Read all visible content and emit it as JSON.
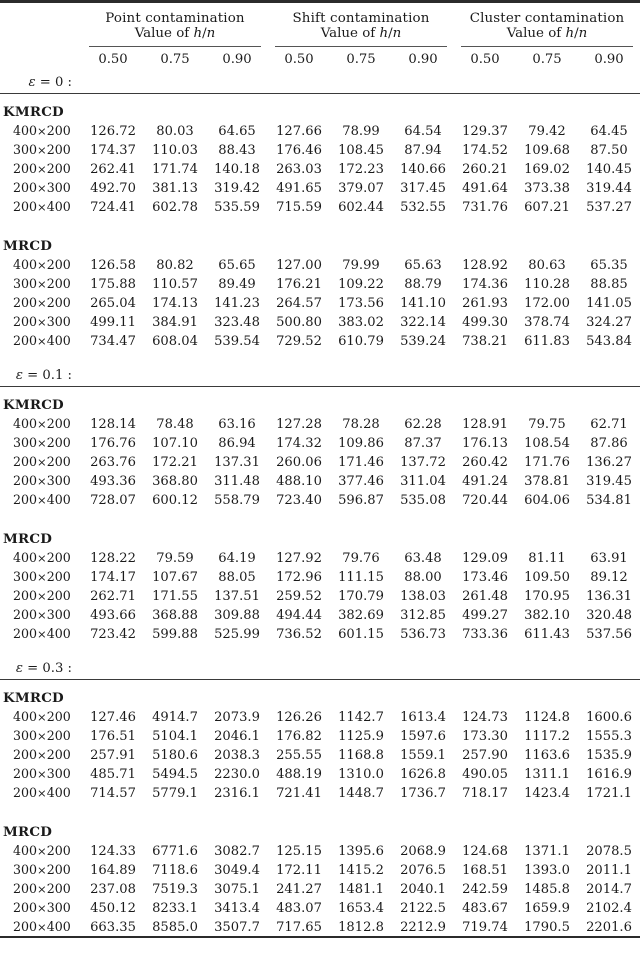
{
  "table": {
    "groups": [
      {
        "title": "Point contamination",
        "subtitle": "Value of h/n"
      },
      {
        "title": "Shift contamination",
        "subtitle": "Value of h/n"
      },
      {
        "title": "Cluster contamination",
        "subtitle": "Value of h/n"
      }
    ],
    "hn_headers": [
      "0.50",
      "0.75",
      "0.90",
      "0.50",
      "0.75",
      "0.90",
      "0.50",
      "0.75",
      "0.90"
    ],
    "row_labels": [
      "400×200",
      "300×200",
      "200×200",
      "200×300",
      "200×400"
    ],
    "sections": [
      {
        "epsilon_label": "ε = 0 :",
        "blocks": [
          {
            "name": "KMRCD",
            "rows": [
              {
                "label": "400×200",
                "values": [
                  "126.72",
                  "80.03",
                  "64.65",
                  "127.66",
                  "78.99",
                  "64.54",
                  "129.37",
                  "79.42",
                  "64.45"
                ]
              },
              {
                "label": "300×200",
                "values": [
                  "174.37",
                  "110.03",
                  "88.43",
                  "176.46",
                  "108.45",
                  "87.94",
                  "174.52",
                  "109.68",
                  "87.50"
                ]
              },
              {
                "label": "200×200",
                "values": [
                  "262.41",
                  "171.74",
                  "140.18",
                  "263.03",
                  "172.23",
                  "140.66",
                  "260.21",
                  "169.02",
                  "140.45"
                ]
              },
              {
                "label": "200×300",
                "values": [
                  "492.70",
                  "381.13",
                  "319.42",
                  "491.65",
                  "379.07",
                  "317.45",
                  "491.64",
                  "373.38",
                  "319.44"
                ]
              },
              {
                "label": "200×400",
                "values": [
                  "724.41",
                  "602.78",
                  "535.59",
                  "715.59",
                  "602.44",
                  "532.55",
                  "731.76",
                  "607.21",
                  "537.27"
                ]
              }
            ]
          },
          {
            "name": "MRCD",
            "rows": [
              {
                "label": "400×200",
                "values": [
                  "126.58",
                  "80.82",
                  "65.65",
                  "127.00",
                  "79.99",
                  "65.63",
                  "128.92",
                  "80.63",
                  "65.35"
                ]
              },
              {
                "label": "300×200",
                "values": [
                  "175.88",
                  "110.57",
                  "89.49",
                  "176.21",
                  "109.22",
                  "88.79",
                  "174.36",
                  "110.28",
                  "88.85"
                ]
              },
              {
                "label": "200×200",
                "values": [
                  "265.04",
                  "174.13",
                  "141.23",
                  "264.57",
                  "173.56",
                  "141.10",
                  "261.93",
                  "172.00",
                  "141.05"
                ]
              },
              {
                "label": "200×300",
                "values": [
                  "499.11",
                  "384.91",
                  "323.48",
                  "500.80",
                  "383.02",
                  "322.14",
                  "499.30",
                  "378.74",
                  "324.27"
                ]
              },
              {
                "label": "200×400",
                "values": [
                  "734.47",
                  "608.04",
                  "539.54",
                  "729.52",
                  "610.79",
                  "539.24",
                  "738.21",
                  "611.83",
                  "543.84"
                ]
              }
            ]
          }
        ]
      },
      {
        "epsilon_label": "ε = 0.1 :",
        "blocks": [
          {
            "name": "KMRCD",
            "rows": [
              {
                "label": "400×200",
                "values": [
                  "128.14",
                  "78.48",
                  "63.16",
                  "127.28",
                  "78.28",
                  "62.28",
                  "128.91",
                  "79.75",
                  "62.71"
                ]
              },
              {
                "label": "300×200",
                "values": [
                  "176.76",
                  "107.10",
                  "86.94",
                  "174.32",
                  "109.86",
                  "87.37",
                  "176.13",
                  "108.54",
                  "87.86"
                ]
              },
              {
                "label": "200×200",
                "values": [
                  "263.76",
                  "172.21",
                  "137.31",
                  "260.06",
                  "171.46",
                  "137.72",
                  "260.42",
                  "171.76",
                  "136.27"
                ]
              },
              {
                "label": "200×300",
                "values": [
                  "493.36",
                  "368.80",
                  "311.48",
                  "488.10",
                  "377.46",
                  "311.04",
                  "491.24",
                  "378.81",
                  "319.45"
                ]
              },
              {
                "label": "200×400",
                "values": [
                  "728.07",
                  "600.12",
                  "558.79",
                  "723.40",
                  "596.87",
                  "535.08",
                  "720.44",
                  "604.06",
                  "534.81"
                ]
              }
            ]
          },
          {
            "name": "MRCD",
            "rows": [
              {
                "label": "400×200",
                "values": [
                  "128.22",
                  "79.59",
                  "64.19",
                  "127.92",
                  "79.76",
                  "63.48",
                  "129.09",
                  "81.11",
                  "63.91"
                ]
              },
              {
                "label": "300×200",
                "values": [
                  "174.17",
                  "107.67",
                  "88.05",
                  "172.96",
                  "111.15",
                  "88.00",
                  "173.46",
                  "109.50",
                  "89.12"
                ]
              },
              {
                "label": "200×200",
                "values": [
                  "262.71",
                  "171.55",
                  "137.51",
                  "259.52",
                  "170.79",
                  "138.03",
                  "261.48",
                  "170.95",
                  "136.31"
                ]
              },
              {
                "label": "200×300",
                "values": [
                  "493.66",
                  "368.88",
                  "309.88",
                  "494.44",
                  "382.69",
                  "312.85",
                  "499.27",
                  "382.10",
                  "320.48"
                ]
              },
              {
                "label": "200×400",
                "values": [
                  "723.42",
                  "599.88",
                  "525.99",
                  "736.52",
                  "601.15",
                  "536.73",
                  "733.36",
                  "611.43",
                  "537.56"
                ]
              }
            ]
          }
        ]
      },
      {
        "epsilon_label": "ε = 0.3 :",
        "blocks": [
          {
            "name": "KMRCD",
            "rows": [
              {
                "label": "400×200",
                "values": [
                  "127.46",
                  "4914.7",
                  "2073.9",
                  "126.26",
                  "1142.7",
                  "1613.4",
                  "124.73",
                  "1124.8",
                  "1600.6"
                ]
              },
              {
                "label": "300×200",
                "values": [
                  "176.51",
                  "5104.1",
                  "2046.1",
                  "176.82",
                  "1125.9",
                  "1597.6",
                  "173.30",
                  "1117.2",
                  "1555.3"
                ]
              },
              {
                "label": "200×200",
                "values": [
                  "257.91",
                  "5180.6",
                  "2038.3",
                  "255.55",
                  "1168.8",
                  "1559.1",
                  "257.90",
                  "1163.6",
                  "1535.9"
                ]
              },
              {
                "label": "200×300",
                "values": [
                  "485.71",
                  "5494.5",
                  "2230.0",
                  "488.19",
                  "1310.0",
                  "1626.8",
                  "490.05",
                  "1311.1",
                  "1616.9"
                ]
              },
              {
                "label": "200×400",
                "values": [
                  "714.57",
                  "5779.1",
                  "2316.1",
                  "721.41",
                  "1448.7",
                  "1736.7",
                  "718.17",
                  "1423.4",
                  "1721.1"
                ]
              }
            ]
          },
          {
            "name": "MRCD",
            "rows": [
              {
                "label": "400×200",
                "values": [
                  "124.33",
                  "6771.6",
                  "3082.7",
                  "125.15",
                  "1395.6",
                  "2068.9",
                  "124.68",
                  "1371.1",
                  "2078.5"
                ]
              },
              {
                "label": "300×200",
                "values": [
                  "164.89",
                  "7118.6",
                  "3049.4",
                  "172.11",
                  "1415.2",
                  "2076.5",
                  "168.51",
                  "1393.0",
                  "2011.1"
                ]
              },
              {
                "label": "200×200",
                "values": [
                  "237.08",
                  "7519.3",
                  "3075.1",
                  "241.27",
                  "1481.1",
                  "2040.1",
                  "242.59",
                  "1485.8",
                  "2014.7"
                ]
              },
              {
                "label": "200×300",
                "values": [
                  "450.12",
                  "8233.1",
                  "3413.4",
                  "483.07",
                  "1653.4",
                  "2122.5",
                  "483.67",
                  "1659.9",
                  "2102.4"
                ]
              },
              {
                "label": "200×400",
                "values": [
                  "663.35",
                  "8585.0",
                  "3507.7",
                  "717.65",
                  "1812.8",
                  "2212.9",
                  "719.74",
                  "1790.5",
                  "2201.6"
                ]
              }
            ]
          }
        ]
      }
    ]
  }
}
